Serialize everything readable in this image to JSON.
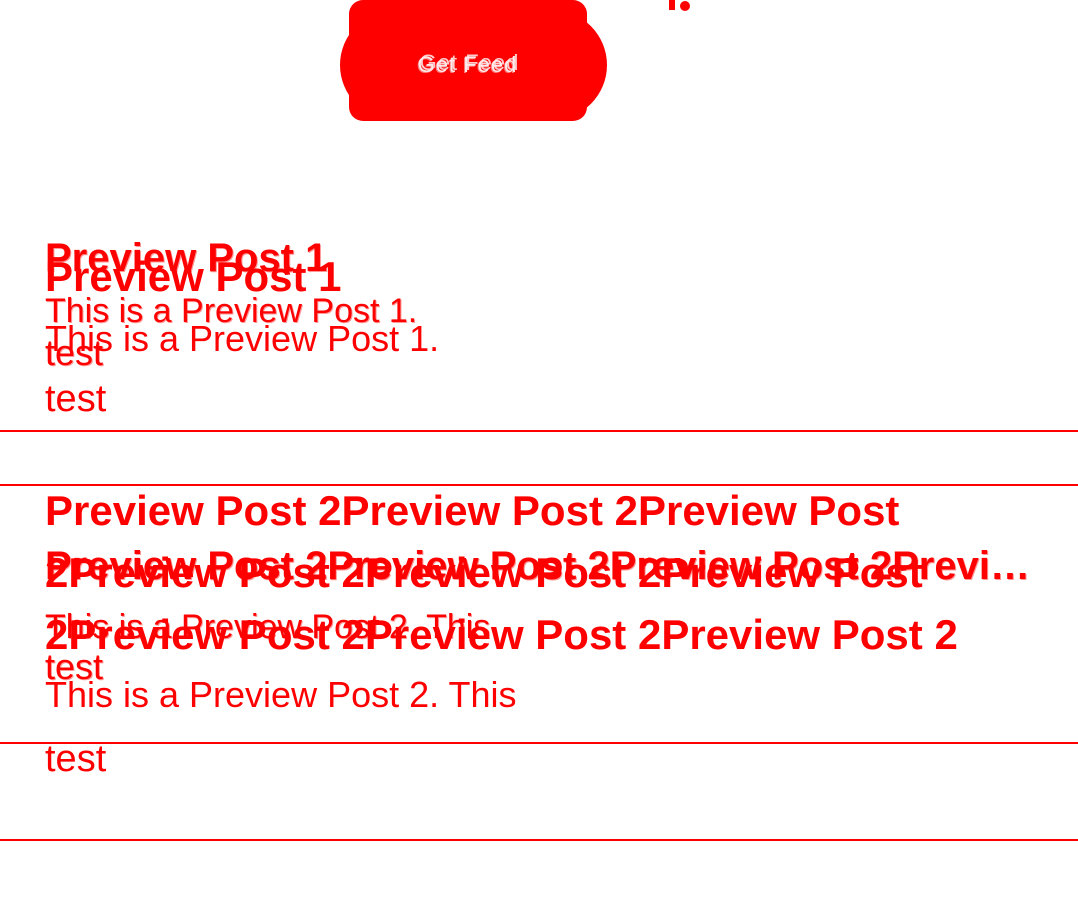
{
  "top_button": {
    "label": "Get Feed"
  },
  "colors": {
    "accent": "#ff0000",
    "background": "#ffffff"
  },
  "posts": [
    {
      "title": "Preview Post 1",
      "body": "This is a Preview Post 1.",
      "tag": "test"
    },
    {
      "title": "Preview Post 2Preview Post 2Preview Post 2Preview Post 2Preview Post 2Preview Post 2Preview Post 2Preview Post 2Preview Post 2",
      "body": "This is a Preview Post 2. This",
      "tag": "test"
    }
  ]
}
